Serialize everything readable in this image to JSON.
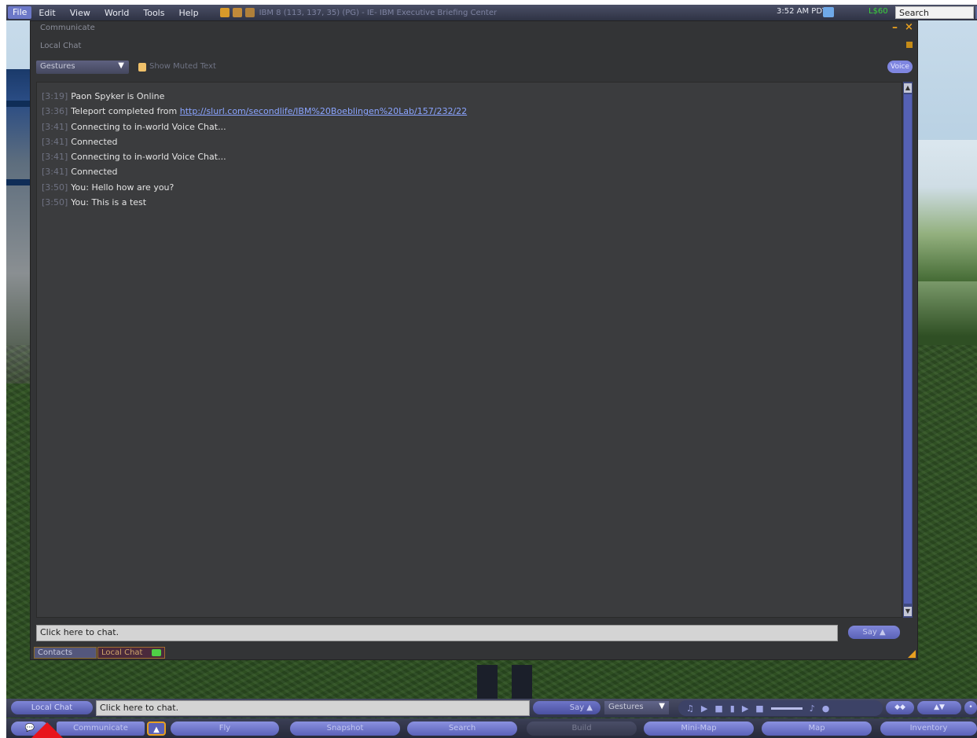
{
  "menubar": {
    "items": [
      "File",
      "Edit",
      "View",
      "World",
      "Tools",
      "Help"
    ],
    "location": "IBM 8 (113, 137, 35) (PG) - IE- IBM Executive Briefing Center",
    "clock": "3:52 AM PDT",
    "balance": "L$60",
    "search_placeholder": "Search"
  },
  "communicate_window": {
    "title": "Communicate",
    "subtitle": "Local Chat",
    "gestures_label": "Gestures",
    "show_muted_label": "Show Muted Text",
    "voice_button": "Voice",
    "messages": [
      {
        "time": "[3:19]",
        "text": "Paon Spyker is Online",
        "link": ""
      },
      {
        "time": "[3:36]",
        "text": "Teleport completed from ",
        "link": "http://slurl.com/secondlife/IBM%20Boeblingen%20Lab/157/232/22"
      },
      {
        "time": "[3:41]",
        "text": "Connecting to in-world Voice Chat...",
        "link": ""
      },
      {
        "time": "[3:41]",
        "text": "Connected",
        "link": ""
      },
      {
        "time": "[3:41]",
        "text": "Connecting to in-world Voice Chat...",
        "link": ""
      },
      {
        "time": "[3:41]",
        "text": "Connected",
        "link": ""
      },
      {
        "time": "[3:50]",
        "text": "You: Hello how are you?",
        "link": ""
      },
      {
        "time": "[3:50]",
        "text": "You: This is a test",
        "link": ""
      }
    ],
    "chat_placeholder": "Click here to chat.",
    "say_button": "Say",
    "tabs": [
      "Contacts",
      "Local Chat"
    ]
  },
  "chatbar": {
    "local_chat_button": "Local Chat",
    "chat_placeholder": "Click here to chat.",
    "say_button": "Say",
    "gestures_label": "Gestures"
  },
  "toolbar": {
    "communicate": "Communicate",
    "fly": "Fly",
    "snapshot": "Snapshot",
    "search": "Search",
    "build": "Build",
    "minimap": "Mini-Map",
    "map": "Map",
    "inventory": "Inventory"
  },
  "colors": {
    "accent": "#e8a020",
    "button_blue": "#6c73c8",
    "panel": "#333436",
    "pointer": "#e8141c"
  }
}
